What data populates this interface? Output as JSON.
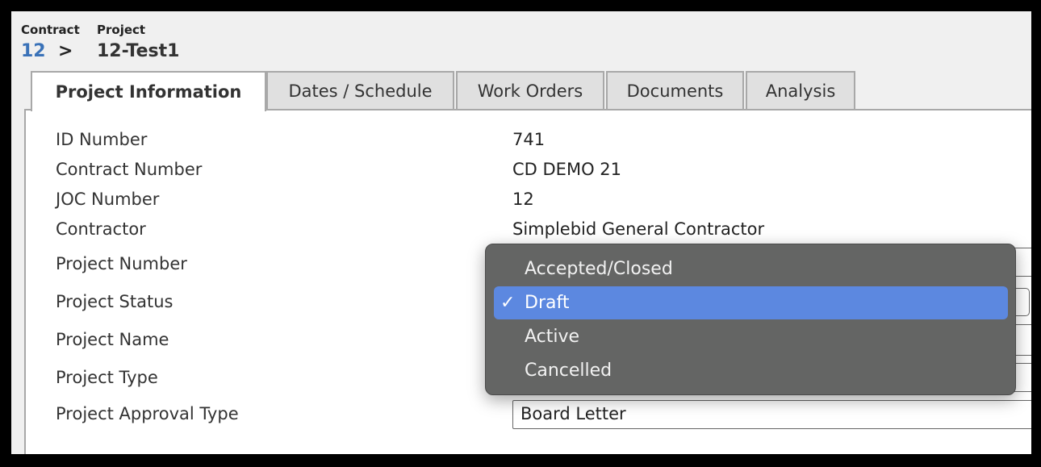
{
  "breadcrumb": {
    "contract_label": "Contract",
    "contract_value": "12",
    "separator": ">",
    "project_label": "Project",
    "project_value": "12-Test1"
  },
  "tabs": [
    {
      "label": "Project Information",
      "active": true
    },
    {
      "label": "Dates / Schedule",
      "active": false
    },
    {
      "label": "Work Orders",
      "active": false
    },
    {
      "label": "Documents",
      "active": false
    },
    {
      "label": "Analysis",
      "active": false
    }
  ],
  "fields": {
    "id_number": {
      "label": "ID Number",
      "value": "741"
    },
    "contract_number": {
      "label": "Contract Number",
      "value": "CD DEMO 21"
    },
    "joc_number": {
      "label": "JOC Number",
      "value": "12"
    },
    "contractor": {
      "label": "Contractor",
      "value": "Simplebid General Contractor"
    },
    "project_number": {
      "label": "Project Number"
    },
    "project_status": {
      "label": "Project Status",
      "value": "Draft"
    },
    "project_name": {
      "label": "Project Name"
    },
    "project_type": {
      "label": "Project Type"
    },
    "project_approval_type": {
      "label": "Project Approval Type",
      "value": "Board Letter"
    }
  },
  "status_dropdown": {
    "options": [
      "Accepted/Closed",
      "Draft",
      "Active",
      "Cancelled"
    ],
    "selected": "Draft",
    "check_icon": "✓"
  },
  "colors": {
    "link": "#3a72b8",
    "selected_option": "#5c88e0",
    "dropdown_bg": "#646564"
  }
}
